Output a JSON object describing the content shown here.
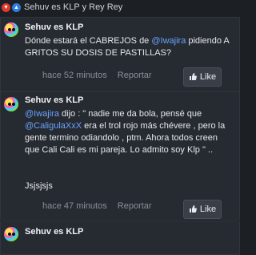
{
  "reactions": {
    "summary": "Sehuv es KLP y Rey Rey"
  },
  "posts": [
    {
      "author": "Sehuv es KLP",
      "text_1": "Dónde estará el CABREJOS de ",
      "mention_1": "@Iwajira",
      "text_2": " pidiendo A GRITOS SU DOSIS DE PASTILLAS?",
      "time": "hace 52 minutos",
      "report": "Reportar",
      "like": "Like"
    },
    {
      "author": "Sehuv es KLP",
      "mention_1": "@Iwajira",
      "text_1": " dijo : \" nadie me da bola, pensé que ",
      "mention_2": "@CaligulaXxX",
      "text_2": " era el trol rojo más chévere , pero la gente termino odiandolo , ptm. Ahora todos creen que Cali Cali es mi pareja. Lo admito soy Klp \" ..",
      "text_3": "Jsjsjsjs",
      "time": "hace 47 minutos",
      "report": "Reportar",
      "like": "Like"
    },
    {
      "author": "Sehuv es KLP"
    }
  ],
  "colors": {
    "mention": "#6aa3ff",
    "background": "#1c1f24",
    "card": "#262a31"
  }
}
